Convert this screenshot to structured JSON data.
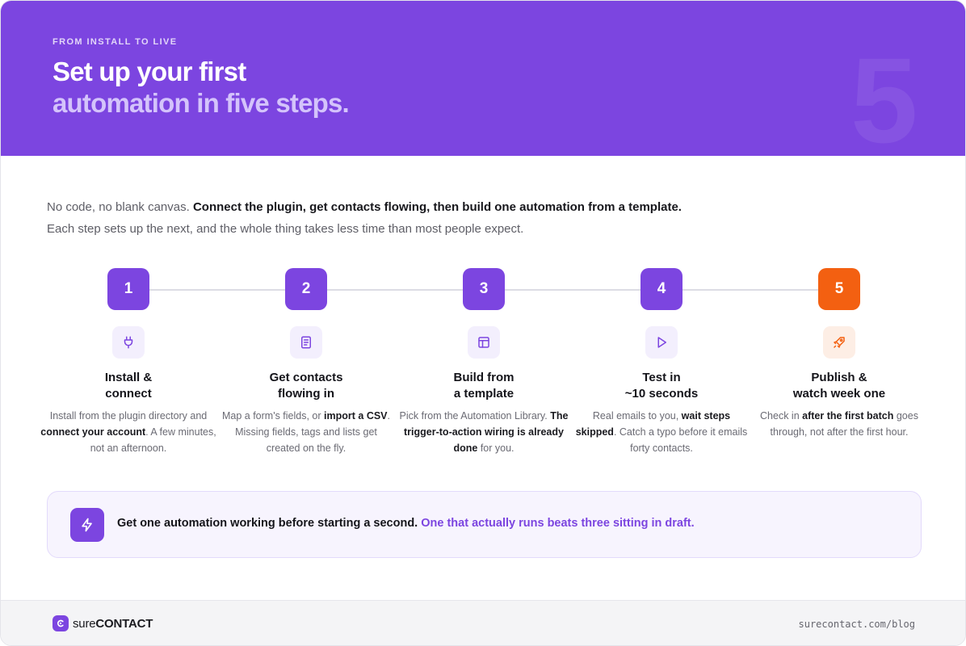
{
  "header": {
    "eyebrow": "FROM INSTALL TO LIVE",
    "title_line1": "Set up your first",
    "title_line2": "automation in five steps.",
    "watermark_number": "5"
  },
  "intro": {
    "lead": "No code, no blank canvas.",
    "bold": "Connect the plugin, get contacts flowing, then build one automation from a template.",
    "rest": "Each step sets up the next, and the whole thing takes less time than most people expect."
  },
  "steps": [
    {
      "number": "1",
      "icon": "plug-icon",
      "title_line1": "Install &",
      "title_line2": "connect",
      "desc": [
        {
          "text": "Install from the plugin directory and ",
          "bold": false
        },
        {
          "text": "connect your account",
          "bold": true
        },
        {
          "text": ". A few minutes, not an afternoon.",
          "bold": false
        }
      ]
    },
    {
      "number": "2",
      "icon": "document-icon",
      "title_line1": "Get contacts",
      "title_line2": "flowing in",
      "desc": [
        {
          "text": "Map a form's fields, or ",
          "bold": false
        },
        {
          "text": "import a CSV",
          "bold": true
        },
        {
          "text": ". Missing fields, tags and lists get created on the fly.",
          "bold": false
        }
      ]
    },
    {
      "number": "3",
      "icon": "layout-icon",
      "title_line1": "Build from",
      "title_line2": "a template",
      "desc": [
        {
          "text": "Pick from the Automation Library. ",
          "bold": false
        },
        {
          "text": "The trigger-to-action wiring is already done",
          "bold": true
        },
        {
          "text": " for you.",
          "bold": false
        }
      ]
    },
    {
      "number": "4",
      "icon": "play-icon",
      "title_line1": "Test in",
      "title_line2": "~10 seconds",
      "desc": [
        {
          "text": "Real emails to you, ",
          "bold": false
        },
        {
          "text": "wait steps skipped",
          "bold": true
        },
        {
          "text": ". Catch a typo before it emails forty contacts.",
          "bold": false
        }
      ]
    },
    {
      "number": "5",
      "icon": "rocket-icon",
      "title_line1": "Publish &",
      "title_line2": "watch week one",
      "desc": [
        {
          "text": "Check in ",
          "bold": false
        },
        {
          "text": "after the first batch",
          "bold": true
        },
        {
          "text": " goes through, not after the first hour.",
          "bold": false
        }
      ]
    }
  ],
  "tip": {
    "icon": "lightning-icon",
    "text": "Get one automation working before starting a second.",
    "accent": "One that actually runs beats three sitting in draft."
  },
  "footer": {
    "brand_a": "sure",
    "brand_b": "CONTACT",
    "url": "surecontact.com/blog"
  },
  "colors": {
    "brand_purple": "#7c45e0",
    "highlight_orange": "#f36011"
  }
}
